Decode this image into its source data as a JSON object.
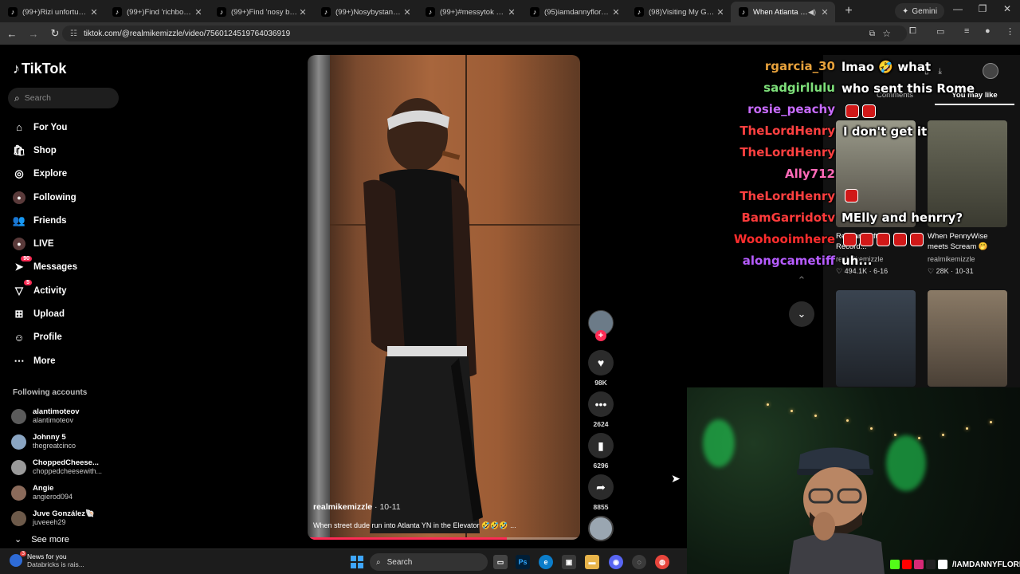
{
  "browser": {
    "tabs": [
      {
        "title": "(99+)Rizi unfortunately",
        "active": false
      },
      {
        "title": "(99+)Find 'richboycardy",
        "active": false
      },
      {
        "title": "(99+)Find 'nosy bystand",
        "active": false
      },
      {
        "title": "(99+)Nosybystander wa",
        "active": false
      },
      {
        "title": "(99+)#messytok #rizi #",
        "active": false
      },
      {
        "title": "(95)iamdannyflores (@",
        "active": false
      },
      {
        "title": "(98)Visiting My Granny",
        "active": false
      },
      {
        "title": "When Atlanta Stree",
        "active": true
      }
    ],
    "gemini_label": "Gemini",
    "url": "tiktok.com/@realmikemizzle/video/7560124519764036919"
  },
  "sidebar": {
    "logo": "TikTok",
    "search_placeholder": "Search",
    "nav": [
      {
        "label": "For You",
        "icon": "home-icon",
        "badge": ""
      },
      {
        "label": "Shop",
        "icon": "shop-bag-icon",
        "badge": ""
      },
      {
        "label": "Explore",
        "icon": "compass-icon",
        "badge": ""
      },
      {
        "label": "Following",
        "icon": "following-avatar-icon",
        "badge": ""
      },
      {
        "label": "Friends",
        "icon": "friends-icon",
        "badge": ""
      },
      {
        "label": "LIVE",
        "icon": "live-avatar-icon",
        "badge": ""
      },
      {
        "label": "Messages",
        "icon": "messages-icon",
        "badge": "90"
      },
      {
        "label": "Activity",
        "icon": "activity-icon",
        "badge": "5"
      },
      {
        "label": "Upload",
        "icon": "upload-icon",
        "badge": ""
      },
      {
        "label": "Profile",
        "icon": "profile-icon",
        "badge": ""
      },
      {
        "label": "More",
        "icon": "more-dots-icon",
        "badge": ""
      }
    ],
    "following_title": "Following accounts",
    "accounts": [
      {
        "name": "alantimoteov",
        "handle": "alantimoteov"
      },
      {
        "name": "Johnny 5",
        "handle": "thegreatcinco"
      },
      {
        "name": "ChoppedCheese...",
        "handle": "choppedcheesewith..."
      },
      {
        "name": "Angie",
        "handle": "angierod094"
      },
      {
        "name": "Juve González🐚",
        "handle": "juveeeh29"
      }
    ],
    "see_more": "See more"
  },
  "video": {
    "username": "realmikemizzle",
    "date": " · 10-11",
    "caption": "When street dude run into Atlanta YN in the Elevator 🤣🤣🤣 ...",
    "progress": 0.73
  },
  "actions": {
    "likes": "98K",
    "comments": "2624",
    "saves": "6296",
    "shares": "8855"
  },
  "right_panel": {
    "tabs": [
      "Comments",
      "You may like"
    ],
    "active_tab": "You may like",
    "cards": [
      {
        "title": "Re... and After Record...",
        "author": "realmikemizzle",
        "likes": "494.1K",
        "date": "6-16"
      },
      {
        "title": "When PennyWise meets Scream 🤭",
        "author": "realmikemizzle",
        "likes": "28K",
        "date": "10-31"
      },
      {
        "title": "",
        "author": "",
        "likes": "",
        "date": ""
      },
      {
        "title": "",
        "author": "",
        "likes": "",
        "date": ""
      }
    ]
  },
  "chat": {
    "names": [
      {
        "name": "rgarcia_30",
        "color": "#e8a23c"
      },
      {
        "name": "sadgirllulu",
        "color": "#7ee07a"
      },
      {
        "name": "rosie_peachy",
        "color": "#c86bff"
      },
      {
        "name": "TheLordHenry",
        "color": "#ff4040"
      },
      {
        "name": "TheLordHenry",
        "color": "#ff4040"
      },
      {
        "name": "Ally712",
        "color": "#ff6ab8"
      },
      {
        "name": "TheLordHenry",
        "color": "#ff4040"
      },
      {
        "name": "BamGarridotv",
        "color": "#ff3b3b"
      },
      {
        "name": "Woohooimhere",
        "color": "#ff2d2d"
      },
      {
        "name": "alongcametiff",
        "color": "#b65cff"
      }
    ],
    "messages": [
      {
        "text": "lmao 🤣 what"
      },
      {
        "text": "who sent this Rome"
      },
      {
        "text": "I don't get it"
      },
      {
        "text": "MElly and henrry?"
      },
      {
        "text": "uh..."
      }
    ]
  },
  "stream": {
    "handle": "/IAMDANNYFLORES"
  },
  "taskbar": {
    "news_title": "News for you",
    "news_sub": "Databricks is rais...",
    "news_badge": "3",
    "search": "Search"
  }
}
